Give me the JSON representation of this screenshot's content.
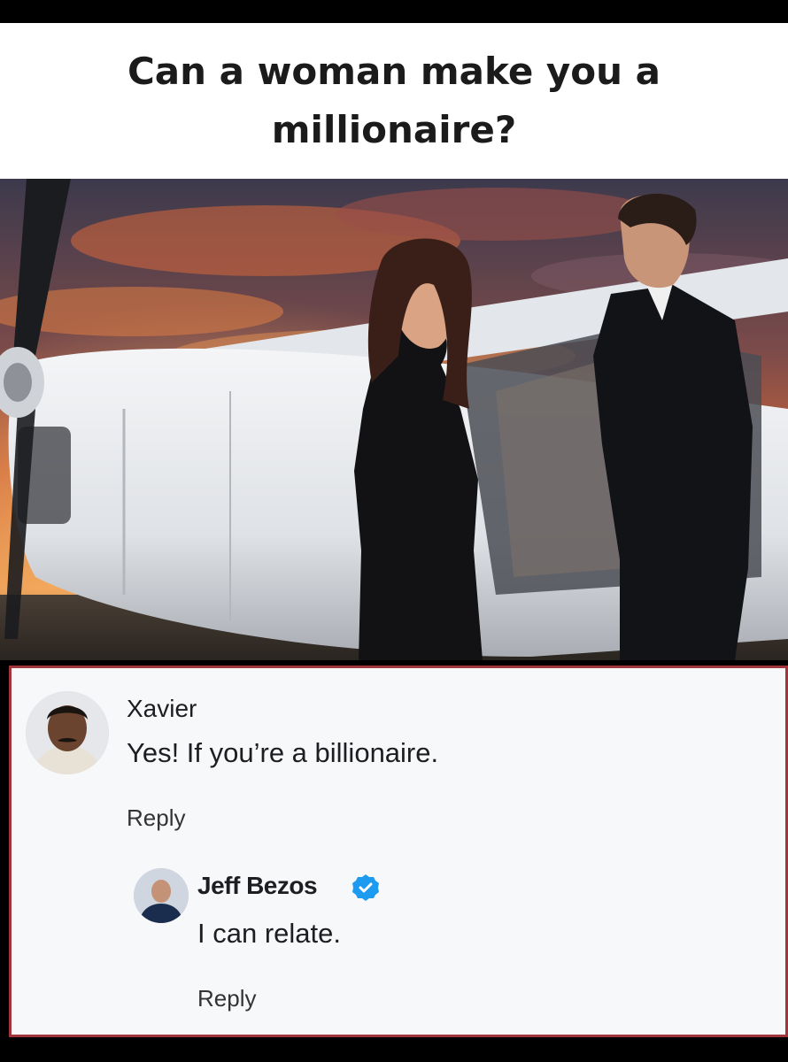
{
  "header": {
    "title": "Can a woman make you a millionaire?"
  },
  "photo": {
    "icon": "airplane-couple-photo",
    "colors": {
      "sky_top": "#3c3a4d",
      "sky_glow": "#e0713a",
      "plane": "#e9ecef",
      "suit": "#111317"
    }
  },
  "comments": [
    {
      "author": "Xavier",
      "text": "Yes! If you’re a billionaire.",
      "action": "Reply",
      "avatar_icon": "avatar-xavier"
    },
    {
      "author": "Jeff Bezos",
      "verified": true,
      "verified_icon": "verified-badge-icon",
      "text": "I can relate.",
      "action": "Reply",
      "avatar_icon": "avatar-jeff-bezos"
    }
  ],
  "colors": {
    "frame_border": "#a0353c",
    "verified_blue": "#1d9bf0",
    "comment_bg": "#f7f8fa"
  }
}
